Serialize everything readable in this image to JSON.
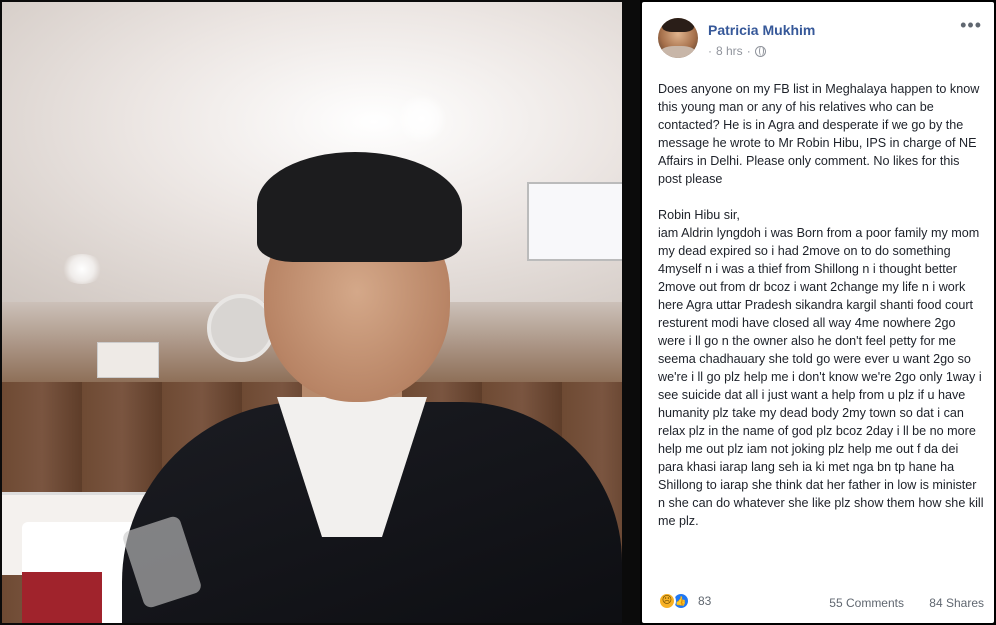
{
  "post": {
    "author": "Patricia Mukhim",
    "time": "8 hrs",
    "time_separator": "·",
    "more_glyph": "•••",
    "paragraph1": "Does anyone on my FB list in Meghalaya happen to know this young man or any of his relatives who can be contacted? He is in Agra and desperate if we go by the message he wrote to Mr Robin Hibu, IPS in charge of NE Affairs in Delhi. Please only comment. No likes for this post please",
    "paragraph2": "Robin Hibu sir,\niam Aldrin lyngdoh i was Born from a poor family my mom my dead expired so i had 2move on to do something 4myself n i was a thief from Shillong n i thought better 2move out from dr bcoz i want 2change my life n i work here Agra uttar Pradesh sikandra kargil shanti food court resturent modi have closed all way 4me nowhere 2go were i ll go n the owner also he don't feel petty for me seema chadhauary she told go were ever u want 2go so we're i ll go plz help me i don't know we're 2go only 1way i see suicide dat all i just want a help from u plz if u have humanity plz take my dead body 2my town so dat i can relax plz in the name of god plz bcoz 2day i ll be no more help me out plz iam not joking plz help me out f da dei para khasi iarap lang seh ia ki met nga bn tp hane ha Shillong to iarap she think dat her father in low is minister n she can do whatever she like plz show them how she kill me plz.",
    "reaction_count": "83",
    "comments": "55 Comments",
    "shares": "84 Shares"
  },
  "icons": {
    "sad": "sad-reaction-icon",
    "like": "like-reaction-icon",
    "globe": "globe-icon",
    "more": "more-options-icon"
  },
  "colors": {
    "author_link": "#365899",
    "meta_gray": "#90949c",
    "like_blue": "#2078f4",
    "sad_yellow": "#f7b125",
    "background": "#000000"
  }
}
